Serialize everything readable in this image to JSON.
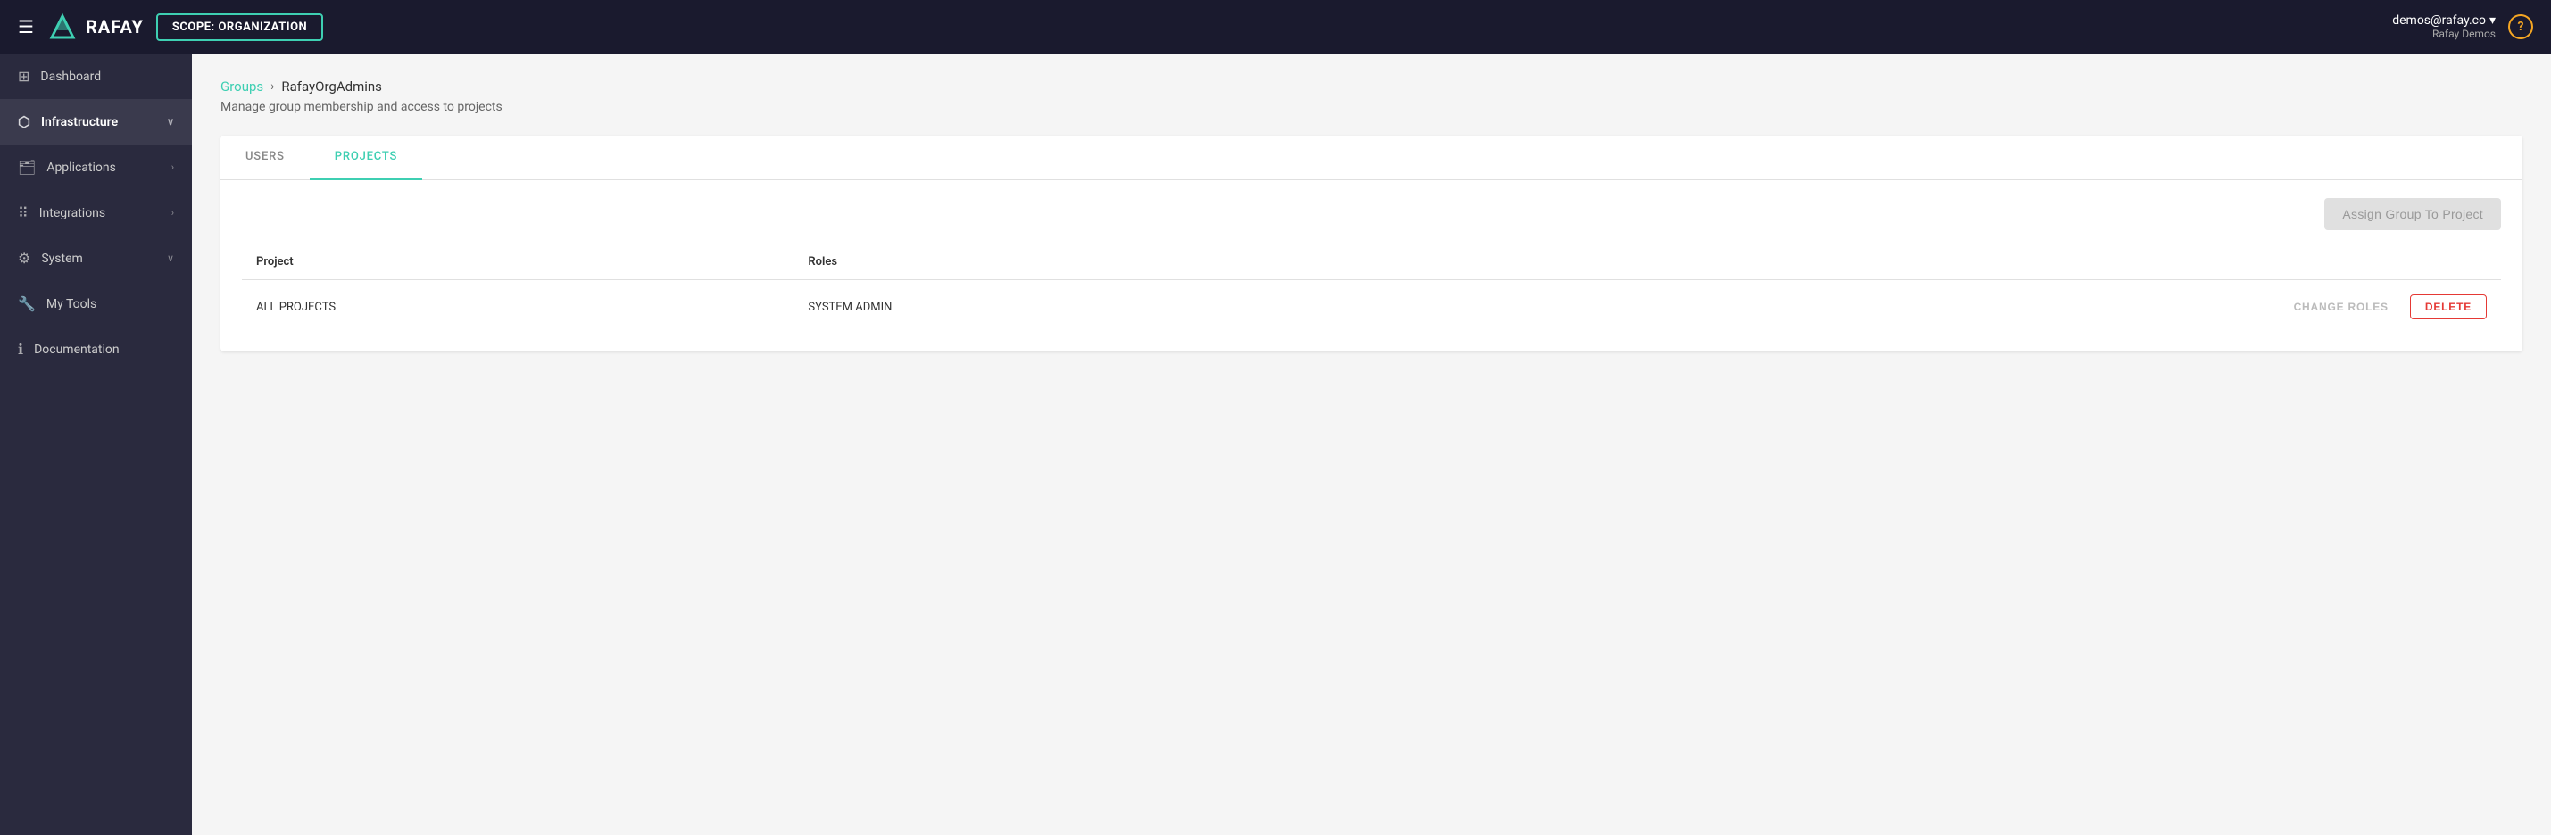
{
  "topnav": {
    "scope_label": "SCOPE: ",
    "scope_value": "ORGANIZATION",
    "user_email": "demos@rafay.co",
    "user_name": "Rafay Demos",
    "help_label": "?"
  },
  "logo": {
    "text": "RAFAY"
  },
  "sidebar": {
    "items": [
      {
        "id": "dashboard",
        "label": "Dashboard",
        "icon": "⊞",
        "active": false,
        "has_chevron": false
      },
      {
        "id": "infrastructure",
        "label": "Infrastructure",
        "icon": "🏗",
        "active": true,
        "has_chevron": true
      },
      {
        "id": "applications",
        "label": "Applications",
        "icon": "🗂",
        "active": false,
        "has_chevron": true
      },
      {
        "id": "integrations",
        "label": "Integrations",
        "icon": "⠿",
        "active": false,
        "has_chevron": true
      },
      {
        "id": "system",
        "label": "System",
        "icon": "⚙",
        "active": false,
        "has_chevron": true
      },
      {
        "id": "mytools",
        "label": "My Tools",
        "icon": "🔧",
        "active": false,
        "has_chevron": false
      },
      {
        "id": "documentation",
        "label": "Documentation",
        "icon": "ℹ",
        "active": false,
        "has_chevron": false
      }
    ]
  },
  "breadcrumb": {
    "parent_label": "Groups",
    "separator": "›",
    "current_label": "RafayOrgAdmins"
  },
  "page": {
    "subtitle": "Manage group membership and access to projects"
  },
  "tabs": [
    {
      "id": "users",
      "label": "USERS",
      "active": false
    },
    {
      "id": "projects",
      "label": "PROJECTS",
      "active": true
    }
  ],
  "toolbar": {
    "assign_button_label": "Assign Group To Project"
  },
  "table": {
    "columns": [
      {
        "id": "project",
        "label": "Project"
      },
      {
        "id": "roles",
        "label": "Roles"
      }
    ],
    "rows": [
      {
        "project": "ALL PROJECTS",
        "roles": "SYSTEM ADMIN",
        "change_roles_label": "CHANGE ROLES",
        "delete_label": "DELETE"
      }
    ]
  }
}
